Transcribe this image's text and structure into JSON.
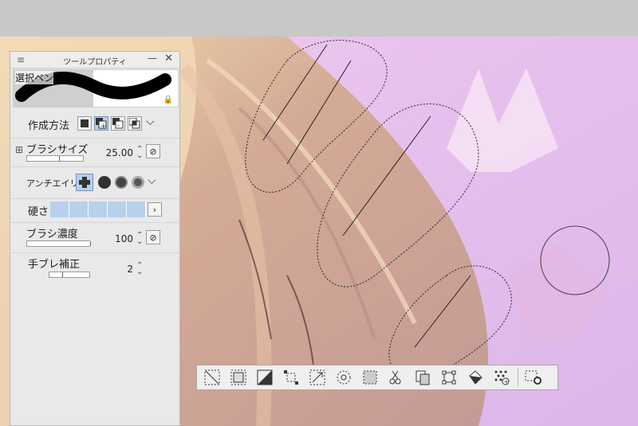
{
  "panel": {
    "title": "ツールプロパティ",
    "tool_name": "選択ペン",
    "menu_icon": "hamburger-icon",
    "rows": {
      "creation_method": {
        "label": "作成方法"
      },
      "brush_size": {
        "label": "ブラシサイズ",
        "value": "25.00"
      },
      "antialiasing": {
        "label": "アンチエイリア"
      },
      "hardness": {
        "label": "硬さ"
      },
      "brush_density": {
        "label": "ブラシ濃度",
        "value": "100"
      },
      "stabilization": {
        "label": "手ブレ補正",
        "value": "2"
      }
    }
  },
  "selection_toolbar": {
    "buttons": [
      "deselect-icon",
      "select-all-icon",
      "invert-selection-icon",
      "expand-selection-icon",
      "shrink-selection-icon",
      "feather-selection-icon",
      "convert-to-layer-icon",
      "cut-paste-icon",
      "copy-paste-icon",
      "scale-rotate-icon",
      "fill-icon",
      "tone-icon",
      "settings-icon"
    ]
  },
  "colors": {
    "accent": "#b7d0ec",
    "sky": "#e9c9ef",
    "hair": "#caa091"
  }
}
